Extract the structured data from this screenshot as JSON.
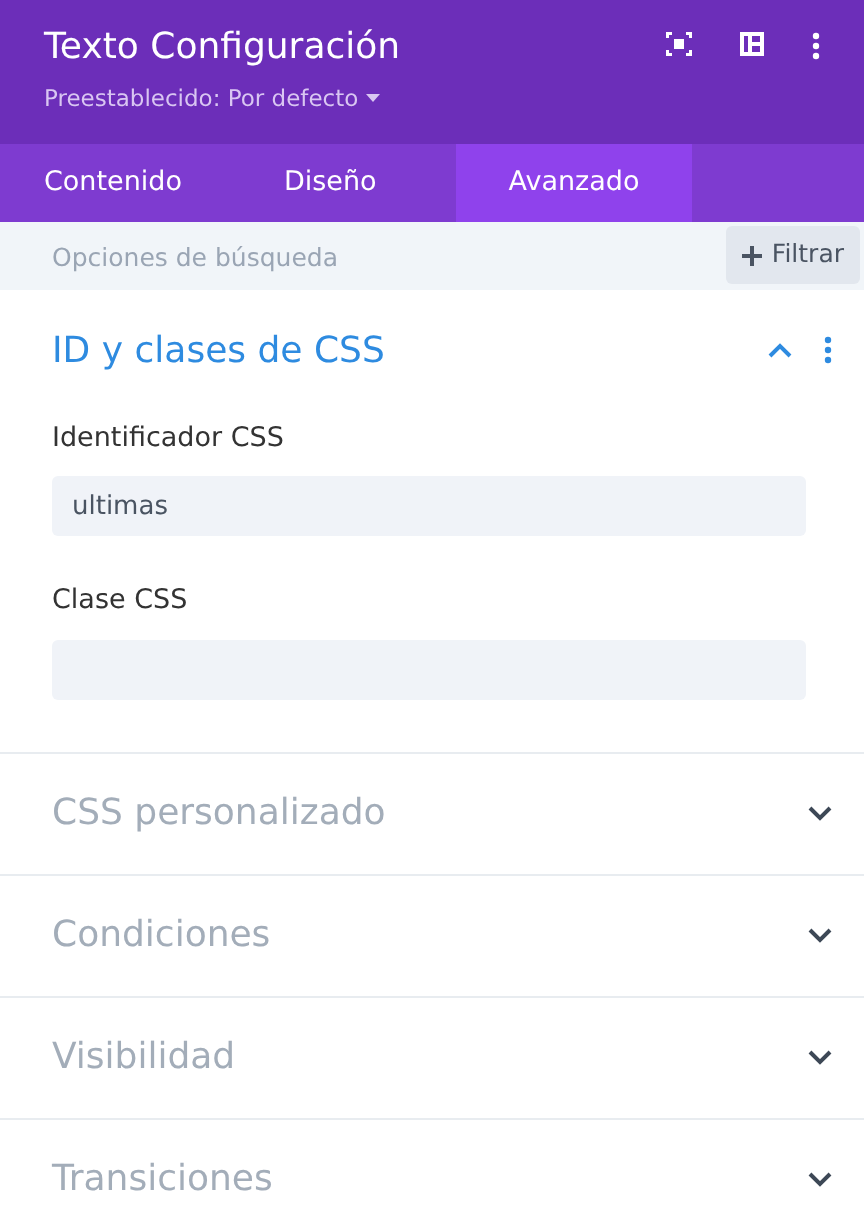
{
  "header": {
    "title": "Texto Configuración",
    "preset": "Preestablecido: Por defecto"
  },
  "tabs": [
    {
      "label": "Contenido",
      "selected": false
    },
    {
      "label": "Diseño",
      "selected": false
    },
    {
      "label": "Avanzado",
      "selected": true
    }
  ],
  "search": {
    "placeholder": "Opciones de búsqueda",
    "filter_button": "Filtrar"
  },
  "sections": [
    {
      "title": "ID y clases de CSS",
      "expanded": true,
      "fields": [
        {
          "label": "Identificador CSS",
          "value": "ultimas"
        },
        {
          "label": "Clase CSS"
        }
      ]
    },
    {
      "title": "CSS personalizado",
      "expanded": false
    },
    {
      "title": "Condiciones",
      "expanded": false
    },
    {
      "title": "Visibilidad",
      "expanded": false
    },
    {
      "title": "Transiciones",
      "expanded": false
    }
  ]
}
